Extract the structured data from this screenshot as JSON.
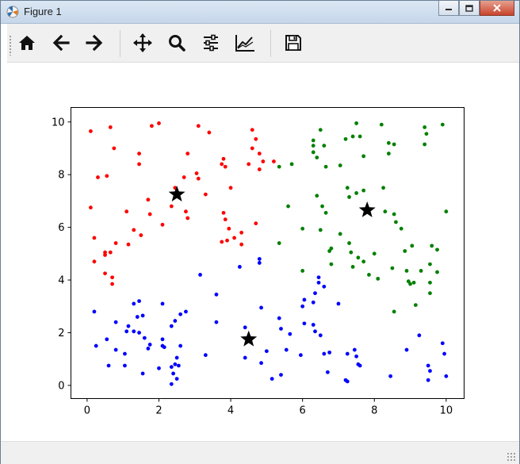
{
  "window": {
    "title": "Figure 1"
  },
  "toolbar": {
    "buttons": [
      {
        "name": "home-button",
        "icon": "home-icon"
      },
      {
        "name": "back-button",
        "icon": "arrow-left-icon"
      },
      {
        "name": "forward-button",
        "icon": "arrow-right-icon"
      },
      {
        "name": "pan-button",
        "icon": "move-icon"
      },
      {
        "name": "zoom-button",
        "icon": "magnifier-icon"
      },
      {
        "name": "subplots-button",
        "icon": "sliders-icon"
      },
      {
        "name": "axes-edit-button",
        "icon": "line-chart-icon"
      },
      {
        "name": "save-button",
        "icon": "floppy-disk-icon"
      }
    ]
  },
  "chart_data": {
    "type": "scatter",
    "title": "",
    "xlabel": "",
    "ylabel": "",
    "xlim": [
      -0.45,
      10.5
    ],
    "ylim": [
      -0.5,
      10.55
    ],
    "xticks": [
      "0",
      "2",
      "4",
      "6",
      "8",
      "10"
    ],
    "yticks": [
      "0",
      "2",
      "4",
      "6",
      "8",
      "10"
    ],
    "grid": false,
    "legend": "none",
    "series": [
      {
        "color": "#ff0000",
        "marker": "dot",
        "points": [
          [
            0.1,
            9.65
          ],
          [
            0.65,
            9.8
          ],
          [
            2.0,
            9.95
          ],
          [
            1.8,
            9.85
          ],
          [
            3.1,
            9.85
          ],
          [
            3.4,
            9.6
          ],
          [
            4.6,
            9.7
          ],
          [
            4.7,
            9.35
          ],
          [
            4.6,
            9.0
          ],
          [
            0.75,
            9.0
          ],
          [
            1.45,
            8.8
          ],
          [
            2.8,
            8.8
          ],
          [
            3.8,
            8.6
          ],
          [
            4.8,
            8.8
          ],
          [
            4.9,
            8.5
          ],
          [
            5.2,
            8.5
          ],
          [
            1.45,
            8.4
          ],
          [
            3.75,
            8.4
          ],
          [
            3.85,
            8.3
          ],
          [
            4.5,
            8.4
          ],
          [
            0.3,
            7.9
          ],
          [
            0.55,
            7.95
          ],
          [
            2.7,
            7.9
          ],
          [
            3.05,
            8.05
          ],
          [
            3.1,
            7.85
          ],
          [
            4.8,
            8.2
          ],
          [
            2.45,
            7.5
          ],
          [
            3.3,
            7.25
          ],
          [
            4.0,
            7.5
          ],
          [
            1.7,
            7.05
          ],
          [
            2.35,
            6.8
          ],
          [
            2.75,
            6.6
          ],
          [
            2.8,
            6.35
          ],
          [
            0.1,
            6.75
          ],
          [
            1.1,
            6.6
          ],
          [
            1.75,
            6.5
          ],
          [
            3.8,
            6.55
          ],
          [
            3.85,
            6.3
          ],
          [
            4.7,
            6.15
          ],
          [
            1.3,
            5.9
          ],
          [
            2.1,
            6.1
          ],
          [
            1.5,
            5.7
          ],
          [
            3.95,
            5.95
          ],
          [
            4.3,
            5.8
          ],
          [
            0.2,
            5.6
          ],
          [
            1.15,
            5.35
          ],
          [
            3.9,
            5.5
          ],
          [
            4.1,
            5.6
          ],
          [
            3.75,
            5.45
          ],
          [
            4.3,
            5.35
          ],
          [
            0.8,
            5.4
          ],
          [
            0.65,
            5.05
          ],
          [
            0.5,
            5.05
          ],
          [
            0.5,
            4.95
          ],
          [
            0.2,
            4.7
          ],
          [
            0.5,
            4.25
          ],
          [
            0.7,
            4.1
          ],
          [
            0.7,
            3.85
          ]
        ]
      },
      {
        "color": "#008000",
        "marker": "dot",
        "points": [
          [
            7.5,
            9.95
          ],
          [
            8.2,
            9.9
          ],
          [
            6.5,
            9.7
          ],
          [
            7.4,
            9.45
          ],
          [
            7.6,
            9.45
          ],
          [
            9.4,
            9.8
          ],
          [
            9.9,
            9.9
          ],
          [
            9.45,
            9.55
          ],
          [
            6.3,
            9.3
          ],
          [
            7.2,
            9.35
          ],
          [
            8.4,
            9.2
          ],
          [
            8.55,
            9.15
          ],
          [
            9.4,
            9.15
          ],
          [
            6.3,
            9.1
          ],
          [
            6.6,
            9.1
          ],
          [
            6.3,
            8.85
          ],
          [
            8.4,
            8.8
          ],
          [
            7.7,
            8.7
          ],
          [
            6.4,
            8.65
          ],
          [
            5.7,
            8.4
          ],
          [
            5.35,
            8.3
          ],
          [
            6.65,
            8.3
          ],
          [
            7.05,
            8.35
          ],
          [
            7.25,
            7.5
          ],
          [
            8.25,
            7.5
          ],
          [
            7.5,
            7.3
          ],
          [
            7.7,
            7.4
          ],
          [
            7.3,
            7.15
          ],
          [
            6.4,
            7.2
          ],
          [
            6.55,
            6.8
          ],
          [
            6.65,
            6.55
          ],
          [
            5.6,
            6.8
          ],
          [
            8.3,
            6.6
          ],
          [
            8.55,
            6.5
          ],
          [
            10.0,
            6.6
          ],
          [
            8.6,
            6.2
          ],
          [
            6.0,
            5.95
          ],
          [
            6.5,
            5.9
          ],
          [
            8.75,
            5.95
          ],
          [
            7.05,
            5.75
          ],
          [
            7.3,
            5.4
          ],
          [
            6.8,
            5.2
          ],
          [
            6.75,
            5.1
          ],
          [
            7.35,
            5.05
          ],
          [
            8.0,
            5.0
          ],
          [
            8.85,
            5.1
          ],
          [
            9.05,
            5.3
          ],
          [
            9.6,
            5.3
          ],
          [
            9.75,
            5.15
          ],
          [
            5.35,
            5.4
          ],
          [
            6.8,
            4.6
          ],
          [
            7.55,
            4.85
          ],
          [
            7.7,
            4.7
          ],
          [
            9.55,
            4.6
          ],
          [
            7.4,
            4.5
          ],
          [
            8.5,
            4.45
          ],
          [
            8.9,
            4.35
          ],
          [
            6.0,
            4.35
          ],
          [
            9.3,
            4.35
          ],
          [
            9.75,
            4.3
          ],
          [
            7.85,
            4.2
          ],
          [
            8.1,
            4.05
          ],
          [
            8.95,
            3.95
          ],
          [
            9.0,
            3.85
          ],
          [
            9.1,
            3.9
          ],
          [
            9.55,
            3.9
          ],
          [
            9.15,
            3.05
          ],
          [
            8.55,
            2.8
          ],
          [
            9.55,
            3.5
          ]
        ]
      },
      {
        "color": "#0000ff",
        "marker": "dot",
        "points": [
          [
            4.8,
            4.8
          ],
          [
            4.8,
            4.65
          ],
          [
            3.15,
            4.2
          ],
          [
            4.25,
            4.5
          ],
          [
            6.45,
            4.1
          ],
          [
            6.45,
            3.9
          ],
          [
            6.35,
            3.5
          ],
          [
            6.6,
            3.75
          ],
          [
            3.6,
            3.45
          ],
          [
            6.05,
            3.25
          ],
          [
            6.3,
            3.15
          ],
          [
            7.0,
            3.1
          ],
          [
            1.3,
            3.1
          ],
          [
            1.45,
            3.2
          ],
          [
            2.1,
            3.1
          ],
          [
            6.0,
            3.0
          ],
          [
            4.85,
            2.95
          ],
          [
            0.2,
            2.8
          ],
          [
            1.4,
            2.6
          ],
          [
            1.55,
            2.65
          ],
          [
            2.75,
            2.8
          ],
          [
            2.6,
            2.7
          ],
          [
            2.45,
            2.45
          ],
          [
            6.05,
            2.35
          ],
          [
            6.3,
            2.3
          ],
          [
            5.35,
            2.55
          ],
          [
            3.6,
            2.4
          ],
          [
            0.8,
            2.4
          ],
          [
            1.15,
            2.25
          ],
          [
            1.1,
            2.05
          ],
          [
            1.3,
            2.05
          ],
          [
            1.45,
            2.0
          ],
          [
            2.35,
            2.25
          ],
          [
            4.4,
            2.2
          ],
          [
            5.4,
            2.15
          ],
          [
            5.65,
            1.95
          ],
          [
            6.35,
            2.05
          ],
          [
            6.5,
            1.9
          ],
          [
            9.25,
            1.9
          ],
          [
            0.25,
            1.5
          ],
          [
            0.55,
            1.75
          ],
          [
            1.6,
            1.8
          ],
          [
            1.75,
            1.55
          ],
          [
            1.7,
            1.4
          ],
          [
            2.1,
            1.5
          ],
          [
            2.15,
            1.45
          ],
          [
            2.1,
            1.75
          ],
          [
            2.6,
            1.5
          ],
          [
            0.8,
            1.35
          ],
          [
            1.05,
            1.2
          ],
          [
            3.3,
            1.15
          ],
          [
            5.0,
            1.3
          ],
          [
            5.55,
            1.35
          ],
          [
            5.95,
            1.15
          ],
          [
            6.75,
            1.25
          ],
          [
            6.6,
            1.2
          ],
          [
            8.9,
            1.35
          ],
          [
            9.9,
            1.6
          ],
          [
            9.95,
            1.2
          ],
          [
            0.6,
            0.75
          ],
          [
            1.05,
            0.75
          ],
          [
            2.5,
            1.05
          ],
          [
            4.4,
            1.05
          ],
          [
            4.85,
            0.85
          ],
          [
            7.25,
            1.2
          ],
          [
            7.45,
            1.35
          ],
          [
            7.5,
            1.1
          ],
          [
            7.55,
            0.8
          ],
          [
            7.6,
            0.75
          ],
          [
            9.5,
            0.75
          ],
          [
            9.55,
            0.55
          ],
          [
            1.55,
            0.45
          ],
          [
            2.0,
            0.65
          ],
          [
            2.35,
            0.7
          ],
          [
            2.45,
            0.8
          ],
          [
            2.55,
            0.75
          ],
          [
            2.4,
            0.45
          ],
          [
            2.5,
            0.25
          ],
          [
            2.35,
            0.05
          ],
          [
            5.15,
            0.25
          ],
          [
            5.4,
            0.4
          ],
          [
            6.7,
            0.5
          ],
          [
            7.25,
            0.15
          ],
          [
            7.2,
            0.2
          ],
          [
            8.45,
            0.35
          ],
          [
            9.5,
            0.2
          ],
          [
            10.0,
            0.35
          ]
        ]
      },
      {
        "color": "#000000",
        "marker": "star",
        "points": [
          [
            2.5,
            7.25
          ],
          [
            7.8,
            6.65
          ],
          [
            4.5,
            1.75
          ]
        ]
      }
    ]
  }
}
